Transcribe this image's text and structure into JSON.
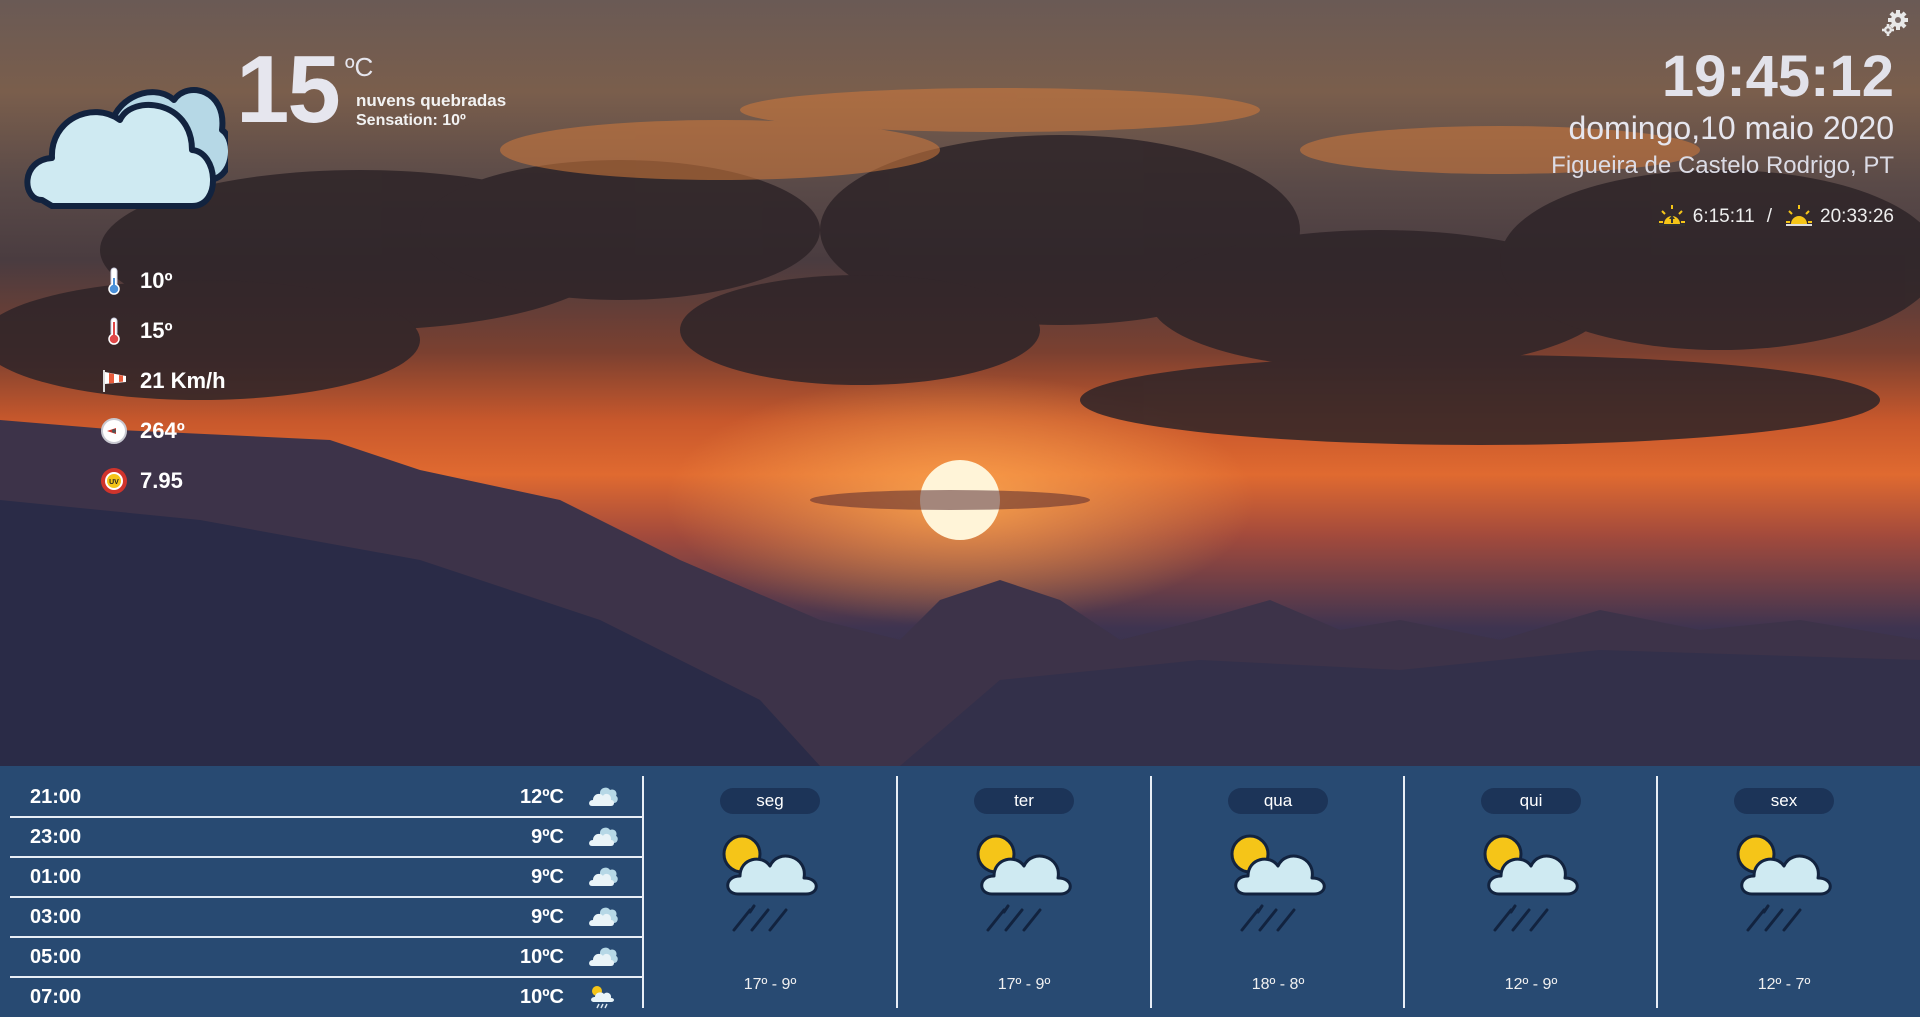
{
  "current": {
    "icon": "cloud-icon",
    "temperature": "15",
    "unit": "ºC",
    "description": "nuvens quebradas",
    "sensation": "Sensation: 10º"
  },
  "stats": [
    {
      "icon": "thermometer-low-icon",
      "value": "10º"
    },
    {
      "icon": "thermometer-high-icon",
      "value": "15º"
    },
    {
      "icon": "windsock-icon",
      "value": "21 Km/h"
    },
    {
      "icon": "compass-icon",
      "value": "264º"
    },
    {
      "icon": "uv-index-icon",
      "value": "7.95"
    }
  ],
  "clock": {
    "time": "19:45:12",
    "date": "domingo,10 maio 2020",
    "location": "Figueira de Castelo Rodrigo, PT",
    "sunrise": "6:15:11",
    "separator": "/",
    "sunset": "20:33:26"
  },
  "hourly": [
    {
      "time": "21:00",
      "temp": "12ºC",
      "icon": "cloud-icon"
    },
    {
      "time": "23:00",
      "temp": "9ºC",
      "icon": "cloud-icon"
    },
    {
      "time": "01:00",
      "temp": "9ºC",
      "icon": "cloud-icon"
    },
    {
      "time": "03:00",
      "temp": "9ºC",
      "icon": "cloud-icon"
    },
    {
      "time": "05:00",
      "temp": "10ºC",
      "icon": "cloud-icon"
    },
    {
      "time": "07:00",
      "temp": "10ºC",
      "icon": "sun-cloud-rain-icon"
    }
  ],
  "daily": [
    {
      "day": "seg",
      "range": "17º - 9º",
      "icon": "sun-cloud-rain-icon"
    },
    {
      "day": "ter",
      "range": "17º - 9º",
      "icon": "sun-cloud-rain-icon"
    },
    {
      "day": "qua",
      "range": "18º - 8º",
      "icon": "sun-cloud-rain-icon"
    },
    {
      "day": "qui",
      "range": "12º - 9º",
      "icon": "sun-cloud-rain-icon"
    },
    {
      "day": "sex",
      "range": "12º - 7º",
      "icon": "sun-cloud-rain-icon"
    }
  ],
  "colors": {
    "panel": "#284a72",
    "pill": "#1c3458",
    "sun": "#f5c518",
    "cloud": "#cfeaf2",
    "outline": "#12233f"
  }
}
